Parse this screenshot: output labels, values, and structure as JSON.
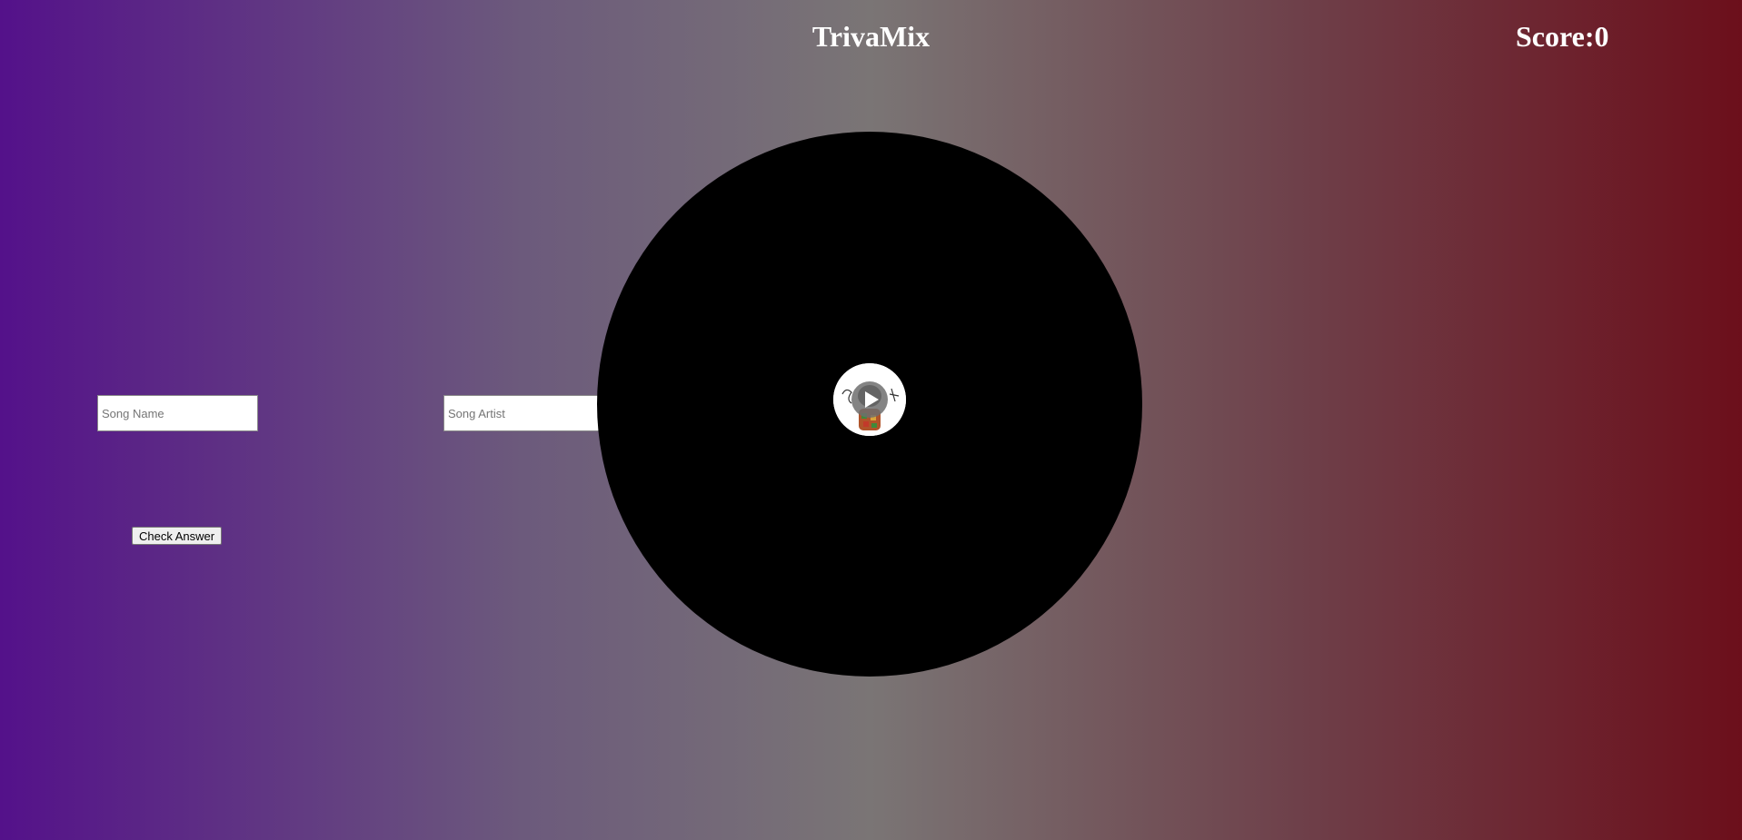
{
  "header": {
    "title": "TrivaMix",
    "score_label": "Score:",
    "score_value": "0"
  },
  "form": {
    "song_name_placeholder": "Song Name",
    "song_name_value": "",
    "song_artist_placeholder": "Song Artist",
    "song_artist_value": "",
    "check_button_label": "Check Answer"
  },
  "player": {
    "record_color": "#000000",
    "label_color": "#ffffff",
    "play_icon": "play-icon"
  },
  "colors": {
    "gradient_left": "#54118a",
    "gradient_mid": "#7a7575",
    "gradient_right": "#6c0f1b",
    "text": "#ffffff"
  }
}
